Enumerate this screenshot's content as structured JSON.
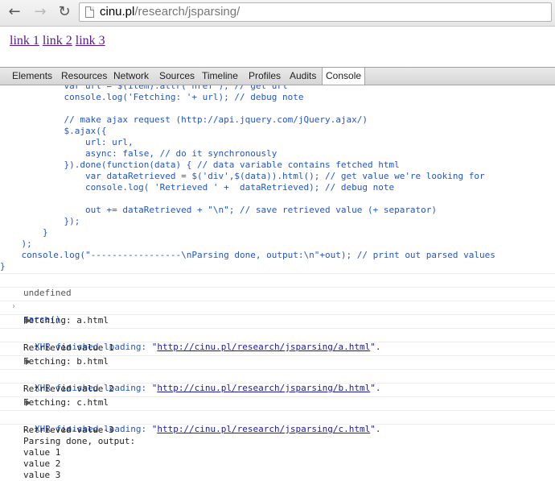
{
  "browser": {
    "back_glyph": "←",
    "forward_glyph": "→",
    "reload_glyph": "↻",
    "url_host": "cinu.pl",
    "url_path": "/research/jsparsing/"
  },
  "page": {
    "links": [
      "link 1",
      "link 2",
      "link 3"
    ]
  },
  "devtools": {
    "tabs": [
      "Elements",
      "Resources",
      "Network",
      "Sources",
      "Timeline",
      "Profiles",
      "Audits",
      "Console"
    ],
    "active_tab": "Console"
  },
  "console": {
    "code_lines": [
      "            var url = $(item).attr('href'); // get url",
      "            console.log('Fetching: '+ url); // debug note",
      "",
      "            // make ajax request (http://api.jquery.com/jQuery.ajax/)",
      "            $.ajax({",
      "                url: url,",
      "                async: false, // do it synchronously",
      "            }).done(function(data) { // data variable contains fetched html",
      "                var dataRetrieved = $('div',$(data)).html(); // get value we're looking for",
      "                console.log( 'Retrieved ' +  dataRetrieved); // debug note",
      "",
      "                out += dataRetrieved + \"\\n\"; // save retrieved value (+ separator)",
      "            });",
      "        }",
      "    );",
      "    console.log(\"-----------------\\nParsing done, output:\\n\"+out); // print out parsed values",
      "}"
    ],
    "undefined_text": "undefined",
    "prompt_glyph": "›",
    "command": "parse()",
    "entries": [
      {
        "kind": "log",
        "text": "Fetching: a.html"
      },
      {
        "kind": "xhr",
        "label": "XHR finished loading: ",
        "url": "http://cinu.pl/research/jsparsing/a.html",
        "q_open": "\"",
        "q_close": "\"."
      },
      {
        "kind": "log",
        "text": "Retrieved value 1"
      },
      {
        "kind": "log",
        "text": "Fetching: b.html"
      },
      {
        "kind": "xhr",
        "label": "XHR finished loading: ",
        "url": "http://cinu.pl/research/jsparsing/b.html",
        "q_open": "\"",
        "q_close": "\"."
      },
      {
        "kind": "log",
        "text": "Retrieved value 2"
      },
      {
        "kind": "log",
        "text": "Fetching: c.html"
      },
      {
        "kind": "xhr",
        "label": "XHR finished loading: ",
        "url": "http://cinu.pl/research/jsparsing/c.html",
        "q_open": "\"",
        "q_close": "\"."
      },
      {
        "kind": "log",
        "text": "Retrieved value 3"
      }
    ],
    "output_lines": [
      "-----------------",
      "Parsing done, output:",
      "value 1",
      "value 2",
      "value 3"
    ]
  }
}
